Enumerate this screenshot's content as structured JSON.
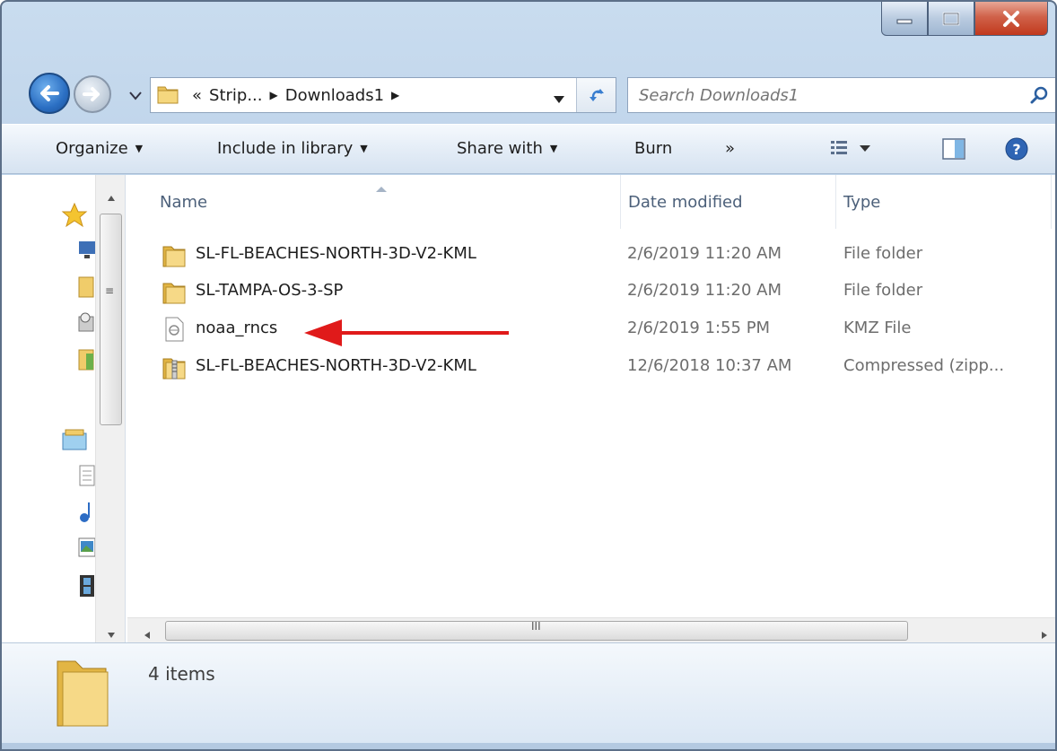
{
  "window": {
    "caption_buttons": [
      "minimize",
      "maximize",
      "close"
    ]
  },
  "address_bar": {
    "breadcrumbs": [
      "«",
      "Strip...",
      "▶",
      "Downloads1",
      "▶"
    ]
  },
  "search": {
    "placeholder": "Search Downloads1"
  },
  "toolbar": {
    "organize": "Organize",
    "include_in_library": "Include in library",
    "share_with": "Share with",
    "burn": "Burn",
    "more": "»"
  },
  "columns": {
    "name": "Name",
    "date_modified": "Date modified",
    "type": "Type"
  },
  "files": [
    {
      "name": "SL-FL-BEACHES-NORTH-3D-V2-KML",
      "date": "2/6/2019 11:20 AM",
      "type": "File folder",
      "icon": "folder-icon"
    },
    {
      "name": "SL-TAMPA-OS-3-SP",
      "date": "2/6/2019 11:20 AM",
      "type": "File folder",
      "icon": "folder-icon"
    },
    {
      "name": "noaa_rncs",
      "date": "2/6/2019 1:55 PM",
      "type": "KMZ File",
      "icon": "kmz-file-icon"
    },
    {
      "name": "SL-FL-BEACHES-NORTH-3D-V2-KML",
      "date": "12/6/2018 10:37 AM",
      "type": "Compressed (zipp...",
      "icon": "zip-folder-icon"
    }
  ],
  "annotation": {
    "arrow_color": "#e01a1a"
  },
  "details": {
    "item_count": "4 items"
  },
  "colors": {
    "frame": "#b7cee6",
    "close_button": "#c9452a",
    "header_text": "#4c607a"
  }
}
